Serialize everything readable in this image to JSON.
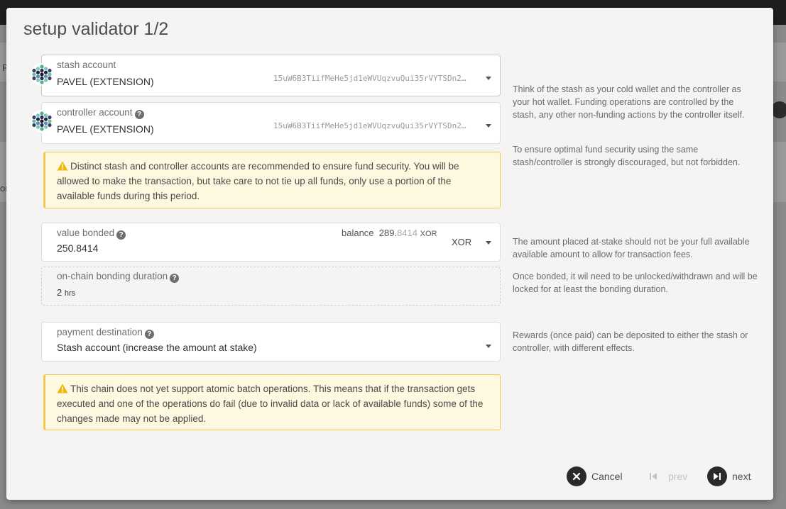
{
  "backdrop": {
    "left_letter_1": "P",
    "left_letter_2": "or",
    "right_letter": "N"
  },
  "modal": {
    "title": "setup validator 1/2"
  },
  "stash": {
    "label": "stash account",
    "name": "PAVEL (EXTENSION)",
    "address": "15uW6B3TiifMeHe5jd1eWVUqzvuQui35rVYTSDn2…"
  },
  "controller": {
    "label": "controller account",
    "name": "PAVEL (EXTENSION)",
    "address": "15uW6B3TiifMeHe5jd1eWVUqzvuQui35rVYTSDn2…"
  },
  "warning_accounts": {
    "text": "Distinct stash and controller accounts are recommended to ensure fund security. You will be allowed to make the transaction, but take care to not tie up all funds, only use a portion of the available funds during this period."
  },
  "value_bonded": {
    "label": "value bonded",
    "value": "250.8414",
    "balance_label": "balance",
    "balance_int": "289.",
    "balance_dec": "8414",
    "balance_unit": "XOR",
    "unit": "XOR"
  },
  "bonding_duration": {
    "label": "on-chain bonding duration",
    "value": "2",
    "unit": "hrs"
  },
  "payment_destination": {
    "label": "payment destination",
    "value": "Stash account (increase the amount at stake)"
  },
  "warning_batch": {
    "text": "This chain does not yet support atomic batch operations. This means that if the transaction gets executed and one of the operations do fail (due to invalid data or lack of available funds) some of the changes made may not be applied."
  },
  "help": {
    "accounts_1": "Think of the stash as your cold wallet and the controller as your hot wallet. Funding operations are controlled by the stash, any other non-funding actions by the controller itself.",
    "accounts_2": "To ensure optimal fund security using the same stash/controller is strongly discouraged, but not forbidden.",
    "value": "The amount placed at-stake should not be your full available available amount to allow for transaction fees.",
    "duration": "Once bonded, it wil need to be unlocked/withdrawn and will be locked for at least the bonding duration.",
    "payment": "Rewards (once paid) can be deposited to either the stash or controller, with different effects."
  },
  "footer": {
    "cancel_label": "Cancel",
    "prev_label": "prev",
    "next_label": "next"
  },
  "colors": {
    "warning_bg": "#fff8e1",
    "warning_border": "#f2c94c",
    "button_dark": "#2a2a2a"
  }
}
